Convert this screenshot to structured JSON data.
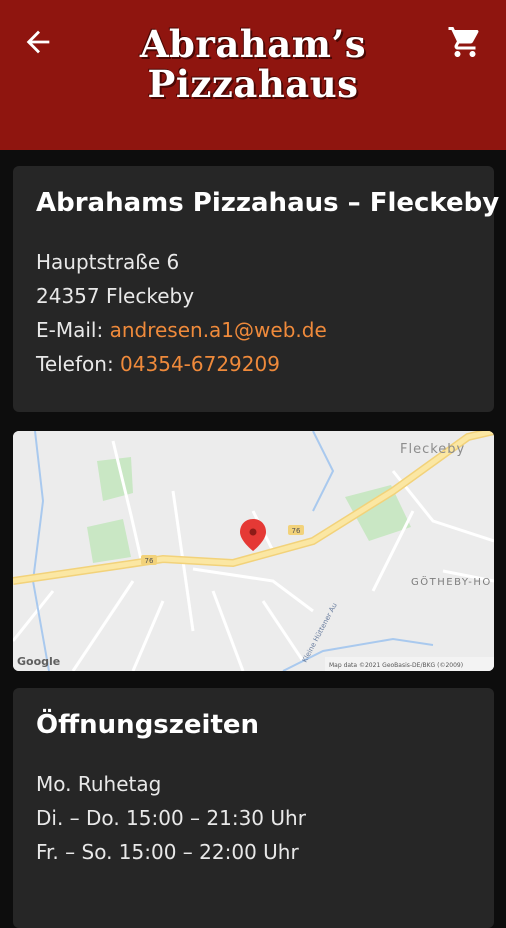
{
  "header": {
    "back_icon": "arrow-left-icon",
    "cart_icon": "cart-icon",
    "logo_line1": "Abraham’s",
    "logo_line2": "Pizzahaus"
  },
  "info_card": {
    "title": "Abrahams Pizzahaus – Fleckeby",
    "street": "Hauptstraße 6",
    "city": "24357 Fleckeby",
    "email_label": "E-Mail:",
    "email": "andresen.a1@web.de",
    "phone_label": "Telefon:",
    "phone": "04354-6729209"
  },
  "map": {
    "place_label": "Fleckeby",
    "district_label": "GÖTHEBY-HO",
    "road_number": "76",
    "river_label": "Kleine Hüttener Au",
    "google_label": "Google",
    "attribution": "Map data ©2021 GeoBasis-DE/BKG (©2009)",
    "marker_icon": "map-pin-icon"
  },
  "hours_card": {
    "title": "Öffnungszeiten",
    "rows": [
      "Mo. Ruhetag",
      "Di. – Do. 15:00 – 21:30 Uhr",
      "Fr. – So. 15:00 – 22:00 Uhr"
    ]
  },
  "colors": {
    "appbar": "#8f150f",
    "background": "#0d0d0d",
    "card": "#262626",
    "link": "#ef8a3b"
  }
}
